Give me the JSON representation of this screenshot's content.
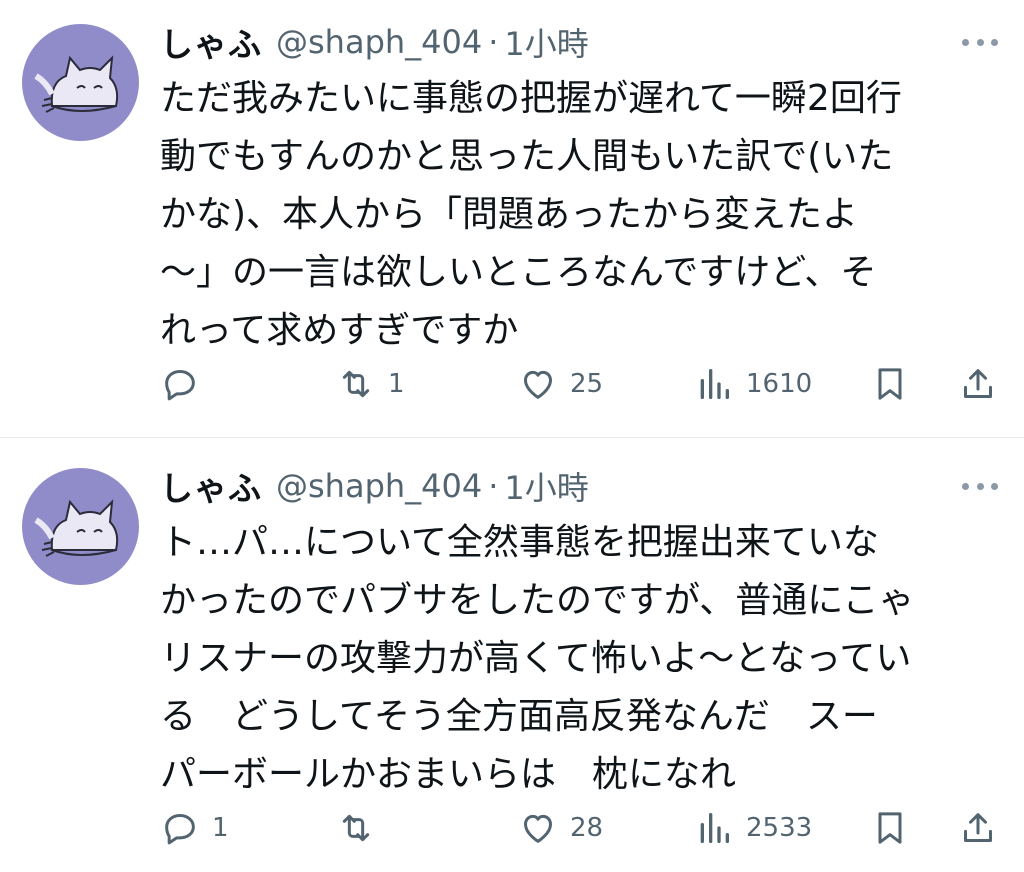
{
  "tweets": [
    {
      "name": "しゃふ",
      "handle": "@shaph_404",
      "separator": "·",
      "time": "1小時",
      "text": "ただ我みたいに事態の把握が遅れて一瞬2回行\n動でもすんのかと思った人間もいた訳で(いた\nかな)、本人から「問題あったから変えたよ\n〜」の一言は欲しいところなんですけど、そ\nれって求めすぎですか",
      "actions": {
        "reply": "",
        "retweet": "1",
        "like": "25",
        "views": "1610"
      },
      "icons": [
        "reply-icon",
        "retweet-icon",
        "like-icon",
        "views-icon",
        "bookmark-icon",
        "share-icon",
        "more-icon"
      ]
    },
    {
      "name": "しゃふ",
      "handle": "@shaph_404",
      "separator": "·",
      "time": "1小時",
      "text": "ト…パ…について全然事態を把握出来ていな\nかったのでパブサをしたのですが、普通にこゃ\nリスナーの攻撃力が高くて怖いよ〜となってい\nる　どうしてそう全方面高反発なんだ　スー\nパーボールかおまいらは　枕になれ",
      "actions": {
        "reply": "1",
        "retweet": "",
        "like": "28",
        "views": "2533"
      },
      "icons": [
        "reply-icon",
        "retweet-icon",
        "like-icon",
        "views-icon",
        "bookmark-icon",
        "share-icon",
        "more-icon"
      ]
    }
  ],
  "colors": {
    "text": "#0f1419",
    "secondary": "#536471",
    "avatar_bg": "#8f8cc9",
    "divider": "#e6e9ec"
  }
}
